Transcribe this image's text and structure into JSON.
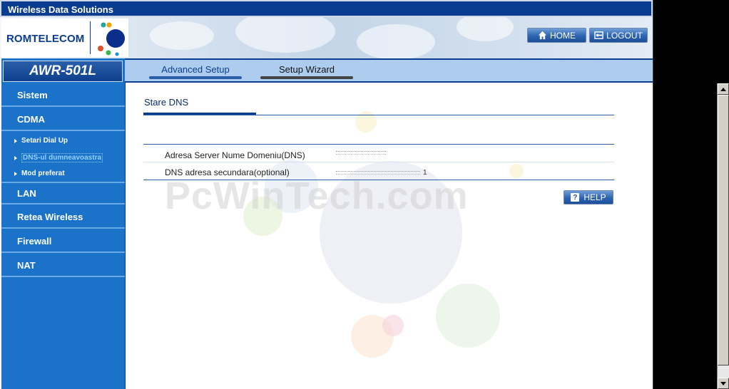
{
  "window": {
    "title": "Wireless Data Solutions"
  },
  "header": {
    "brand": "ROMTELECOM",
    "home_label": "HOME",
    "logout_label": "LOGOUT"
  },
  "sidebar": {
    "model": "AWR-501L",
    "items": [
      {
        "label": "Sistem"
      },
      {
        "label": "CDMA"
      },
      {
        "label": "LAN"
      },
      {
        "label": "Retea Wireless"
      },
      {
        "label": "Firewall"
      },
      {
        "label": "NAT"
      }
    ],
    "cdma_subitems": [
      {
        "label": "Setari Dial Up"
      },
      {
        "label": "DNS-ul dumneavoastra"
      },
      {
        "label": "Mod preferat"
      }
    ]
  },
  "tabs": [
    {
      "label": "Advanced Setup"
    },
    {
      "label": "Setup Wizard"
    }
  ],
  "content": {
    "section_title": "Stare DNS",
    "rows": [
      {
        "label": "Adresa Server Nume Domeniu(DNS)",
        "value": ""
      },
      {
        "label": "DNS adresa secundara(optional)",
        "value": "1"
      }
    ],
    "help_label": "HELP"
  },
  "watermark": "PcWinTech.com",
  "colors": {
    "navy": "#0a3d8f",
    "sidebar_blue": "#1a72c9",
    "tab_bar": "#aecdee",
    "active_link": "#8fd2ff"
  }
}
